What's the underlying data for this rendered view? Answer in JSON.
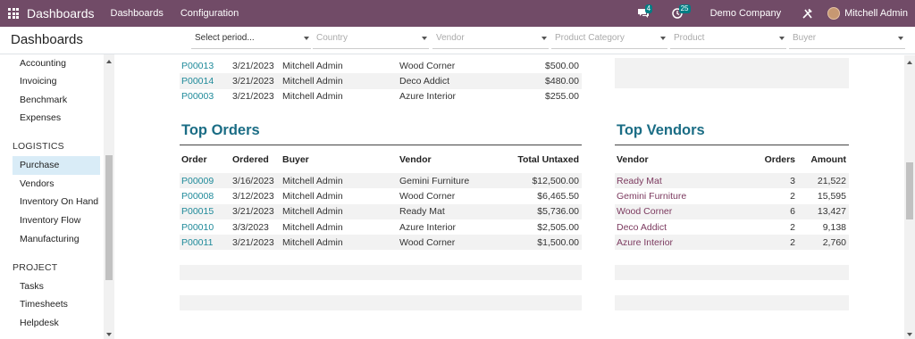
{
  "navbar": {
    "brand": "Dashboards",
    "menus": [
      "Dashboards",
      "Configuration"
    ],
    "messages_badge": "4",
    "activities_badge": "25",
    "company": "Demo Company",
    "user": "Mitchell Admin",
    "icons": [
      "apps-grid-icon",
      "chat-icon",
      "clock-icon",
      "tools-icon"
    ],
    "bg_color": "#714b67",
    "badge_color": "#017e84"
  },
  "control_panel": {
    "title": "Dashboards",
    "filters": {
      "period": "Select period...",
      "country": "Country",
      "vendor": "Vendor",
      "product_category": "Product Category",
      "product": "Product",
      "buyer": "Buyer"
    }
  },
  "sidebar": {
    "top_items": [
      "Accounting",
      "Invoicing",
      "Benchmark",
      "Expenses"
    ],
    "logistics_header": "LOGISTICS",
    "logistics_items": [
      "Purchase",
      "Vendors",
      "Inventory On Hand",
      "Inventory Flow",
      "Manufacturing"
    ],
    "project_header": "PROJECT",
    "project_items": [
      "Tasks",
      "Timesheets",
      "Helpdesk"
    ],
    "active": "Purchase"
  },
  "previous_rows": [
    {
      "order": "P00013",
      "date": "3/21/2023",
      "buyer": "Mitchell Admin",
      "vendor": "Wood Corner",
      "total": "$500.00"
    },
    {
      "order": "P00014",
      "date": "3/21/2023",
      "buyer": "Mitchell Admin",
      "vendor": "Deco Addict",
      "total": "$480.00"
    },
    {
      "order": "P00003",
      "date": "3/21/2023",
      "buyer": "Mitchell Admin",
      "vendor": "Azure Interior",
      "total": "$255.00"
    }
  ],
  "top_orders": {
    "title": "Top Orders",
    "headers": {
      "order": "Order",
      "ordered": "Ordered",
      "buyer": "Buyer",
      "vendor": "Vendor",
      "total": "Total Untaxed"
    },
    "rows": [
      {
        "order": "P00009",
        "date": "3/16/2023",
        "buyer": "Mitchell Admin",
        "vendor": "Gemini Furniture",
        "total": "$12,500.00"
      },
      {
        "order": "P00008",
        "date": "3/12/2023",
        "buyer": "Mitchell Admin",
        "vendor": "Wood Corner",
        "total": "$6,465.50"
      },
      {
        "order": "P00015",
        "date": "3/21/2023",
        "buyer": "Mitchell Admin",
        "vendor": "Ready Mat",
        "total": "$5,736.00"
      },
      {
        "order": "P00010",
        "date": "3/3/2023",
        "buyer": "Mitchell Admin",
        "vendor": "Azure Interior",
        "total": "$2,505.00"
      },
      {
        "order": "P00011",
        "date": "3/21/2023",
        "buyer": "Mitchell Admin",
        "vendor": "Wood Corner",
        "total": "$1,500.00"
      }
    ]
  },
  "top_vendors": {
    "title": "Top Vendors",
    "headers": {
      "vendor": "Vendor",
      "orders": "Orders",
      "amount": "Amount"
    },
    "rows": [
      {
        "vendor": "Ready Mat",
        "orders": "3",
        "amount": "21,522"
      },
      {
        "vendor": "Gemini Furniture",
        "orders": "2",
        "amount": "15,595"
      },
      {
        "vendor": "Wood Corner",
        "orders": "6",
        "amount": "13,427"
      },
      {
        "vendor": "Deco Addict",
        "orders": "2",
        "amount": "9,138"
      },
      {
        "vendor": "Azure Interior",
        "orders": "2",
        "amount": "2,760"
      }
    ]
  }
}
